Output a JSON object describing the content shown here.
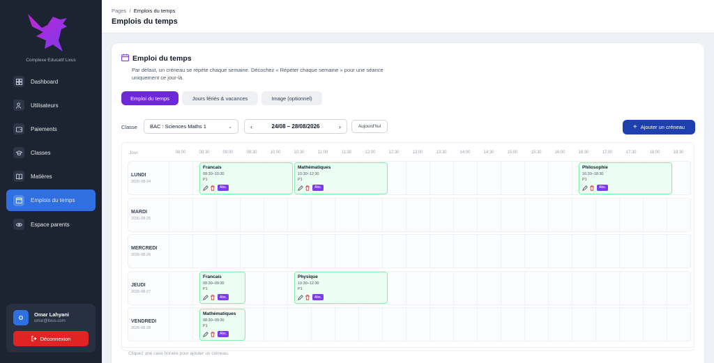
{
  "sidebar": {
    "brand": "Complexe Educatif Lixus",
    "items": [
      {
        "label": "Dashboard",
        "icon": "dashboard-icon"
      },
      {
        "label": "Utilisateurs",
        "icon": "users-icon"
      },
      {
        "label": "Paiements",
        "icon": "wallet-icon"
      },
      {
        "label": "Classes",
        "icon": "graduation-cap-icon"
      },
      {
        "label": "Matières",
        "icon": "book-icon"
      },
      {
        "label": "Emplois du temps",
        "icon": "calendar-icon",
        "active": true
      },
      {
        "label": "Espace parents",
        "icon": "eye-icon"
      }
    ],
    "user": {
      "initial": "O",
      "name": "Omar Lahyani",
      "email": "omar@lixus.com"
    },
    "logout_label": "Déconnexion"
  },
  "header": {
    "breadcrumb_root": "Pages",
    "breadcrumb_sep": "/",
    "breadcrumb_current": "Emplois du temps",
    "title": "Emplois du temps"
  },
  "card": {
    "title": "Emploi du temps",
    "description": "Par défaut, un créneau se répète chaque semaine. Décochez « Répéter chaque semaine » pour une séance uniquement ce jour-là.",
    "tabs": [
      "Emploi du temps",
      "Jours fériés & vacances",
      "Image (optionnel)"
    ],
    "filter_label": "Classe",
    "class_value": "BAC : Sciences Maths 1",
    "week_range": "24/08 – 28/08/2026",
    "today_label": "Aujourd'hui",
    "add_label": "Ajouter un créneau",
    "hint": "Cliquez une case horaire pour ajouter un créneau."
  },
  "grid": {
    "day_header": "Jour",
    "hours": [
      "08:00",
      "08:30",
      "09:00",
      "09:30",
      "10:00",
      "10:30",
      "11:00",
      "11:30",
      "12:00",
      "12:30",
      "13:00",
      "13:30",
      "14:00",
      "14:30",
      "15:00",
      "15:30",
      "16:00",
      "16:30",
      "17:00",
      "17:30",
      "18:00",
      "18:30"
    ],
    "days": [
      {
        "name": "LUNDI",
        "date": "2026-08-24"
      },
      {
        "name": "MARDI",
        "date": "2026-08-25"
      },
      {
        "name": "MERCREDI",
        "date": "2026-08-26"
      },
      {
        "name": "JEUDI",
        "date": "2026-08-27"
      },
      {
        "name": "VENDREDI",
        "date": "2026-08-28"
      }
    ],
    "events": [
      {
        "day": 0,
        "start": "08:30",
        "end": "10:30",
        "title": "Francais",
        "time": "08:30–10:30",
        "room": "P1",
        "badge": "Abs."
      },
      {
        "day": 0,
        "start": "10:30",
        "end": "12:30",
        "title": "Mathématiques",
        "time": "10:30–12:30",
        "room": "P1",
        "badge": "Abs."
      },
      {
        "day": 0,
        "start": "16:30",
        "end": "18:30",
        "title": "Philosophie",
        "time": "16:30–18:30",
        "room": "P1",
        "badge": "Abs."
      },
      {
        "day": 3,
        "start": "08:30",
        "end": "09:30",
        "title": "Francais",
        "time": "08:30–09:30",
        "room": "P1",
        "badge": "Abs."
      },
      {
        "day": 3,
        "start": "10:30",
        "end": "12:30",
        "title": "Physique",
        "time": "10:30–12:30",
        "room": "P1",
        "badge": "Abs."
      },
      {
        "day": 4,
        "start": "08:30",
        "end": "09:30",
        "title": "Mathématiques",
        "time": "08:30–09:30",
        "room": "P1",
        "badge": "Abs."
      }
    ]
  },
  "colors": {
    "accent": "#6d28d9",
    "primary": "#1e40af",
    "active_nav": "#2f6fe0",
    "danger": "#e02424",
    "event_bg": "#ecfdf3"
  }
}
